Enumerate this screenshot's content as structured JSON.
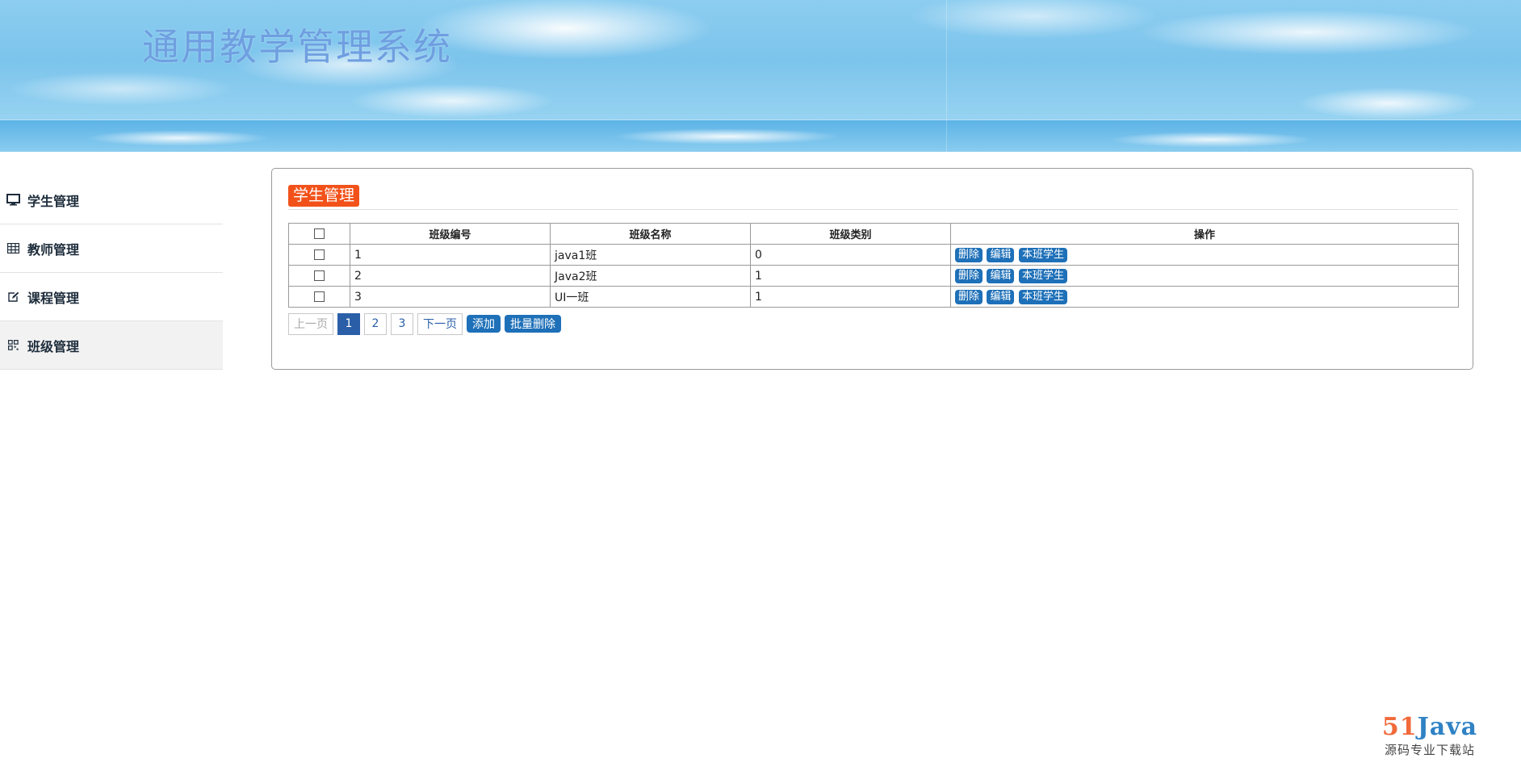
{
  "header": {
    "title": "通用教学管理系统"
  },
  "sidebar": {
    "items": [
      {
        "label": "学生管理",
        "icon": "monitor-icon"
      },
      {
        "label": "教师管理",
        "icon": "table-icon"
      },
      {
        "label": "课程管理",
        "icon": "edit-icon"
      },
      {
        "label": "班级管理",
        "icon": "grid-icon",
        "active": true
      }
    ]
  },
  "main": {
    "panel_title": "学生管理",
    "table": {
      "columns": [
        "班级编号",
        "班级名称",
        "班级类别",
        "操作"
      ],
      "rows": [
        {
          "id": "1",
          "name": "java1班",
          "category": "0"
        },
        {
          "id": "2",
          "name": "Java2班",
          "category": "1"
        },
        {
          "id": "3",
          "name": "UI一班",
          "category": "1"
        }
      ],
      "row_actions": [
        "删除",
        "编辑",
        "本班学生"
      ]
    },
    "pagination": {
      "prev": "上一页",
      "pages": [
        "1",
        "2",
        "3"
      ],
      "current": "1",
      "next": "下一页"
    },
    "actions": {
      "add": "添加",
      "batch_delete": "批量删除"
    }
  },
  "watermark": {
    "brand_number": "51",
    "brand_text": "Java",
    "subtitle": "源码专业下载站"
  },
  "colors": {
    "badge": "#f2521a",
    "button": "#1e70b8",
    "page_current": "#2a5fa8",
    "title": "#6f9fe0"
  }
}
